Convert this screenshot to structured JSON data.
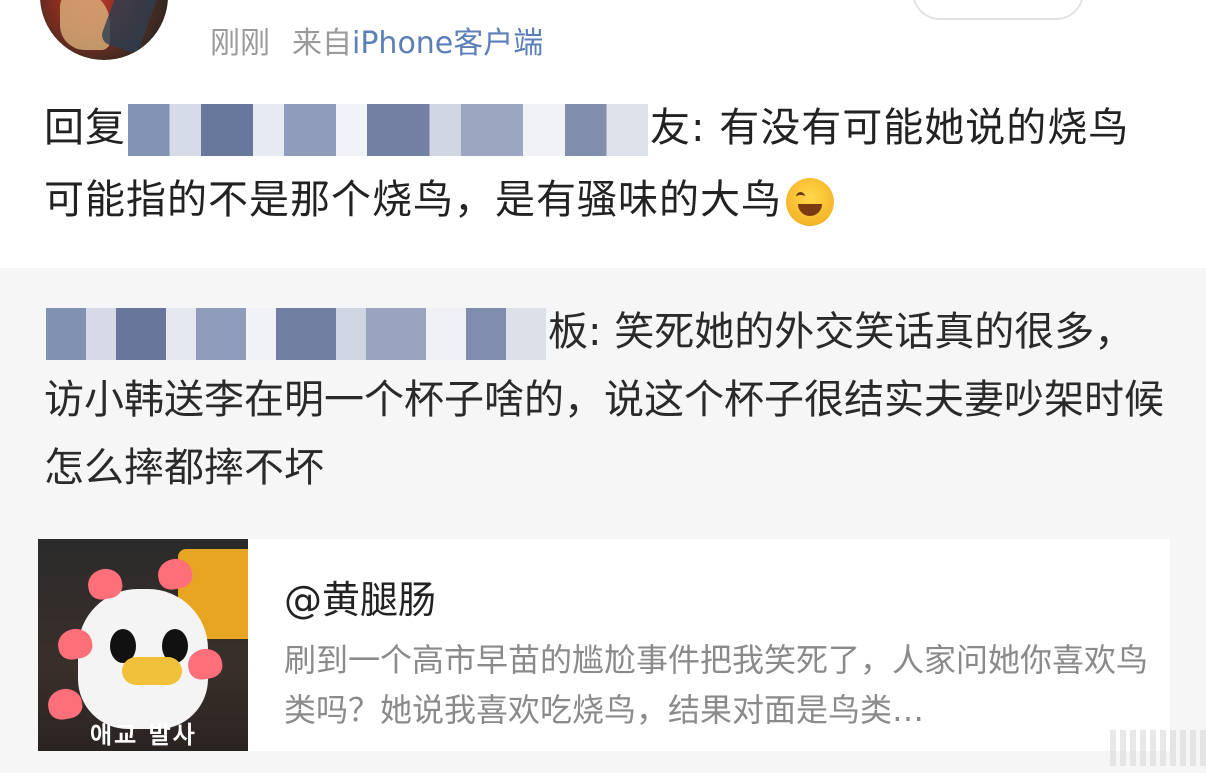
{
  "post": {
    "timestamp": "刚刚",
    "source_prefix": "来自",
    "source_device": "iPhone客户端",
    "reply_prefix": "回复",
    "reply_suffix_char": "友",
    "reply_body": ": 有没有可能她说的烧鸟可能指的不是那个烧鸟，是有骚味的大鸟",
    "emoji_name": "laugh-cry-emoji"
  },
  "quoted": {
    "name_suffix_char": "板",
    "body": ": 笑死她的外交笑话真的很多，访小韩送李在明一个杯子啥的，说这个杯子很结实夫妻吵架时候怎么摔都摔不坏"
  },
  "card": {
    "title": "@黄腿肠",
    "description": "刷到一个高市早苗的尴尬事件把我笑死了，人家问她你喜欢鸟类吗？她说我喜欢吃烧鸟，结果对面是鸟类…",
    "image_caption": "애교 발사"
  }
}
